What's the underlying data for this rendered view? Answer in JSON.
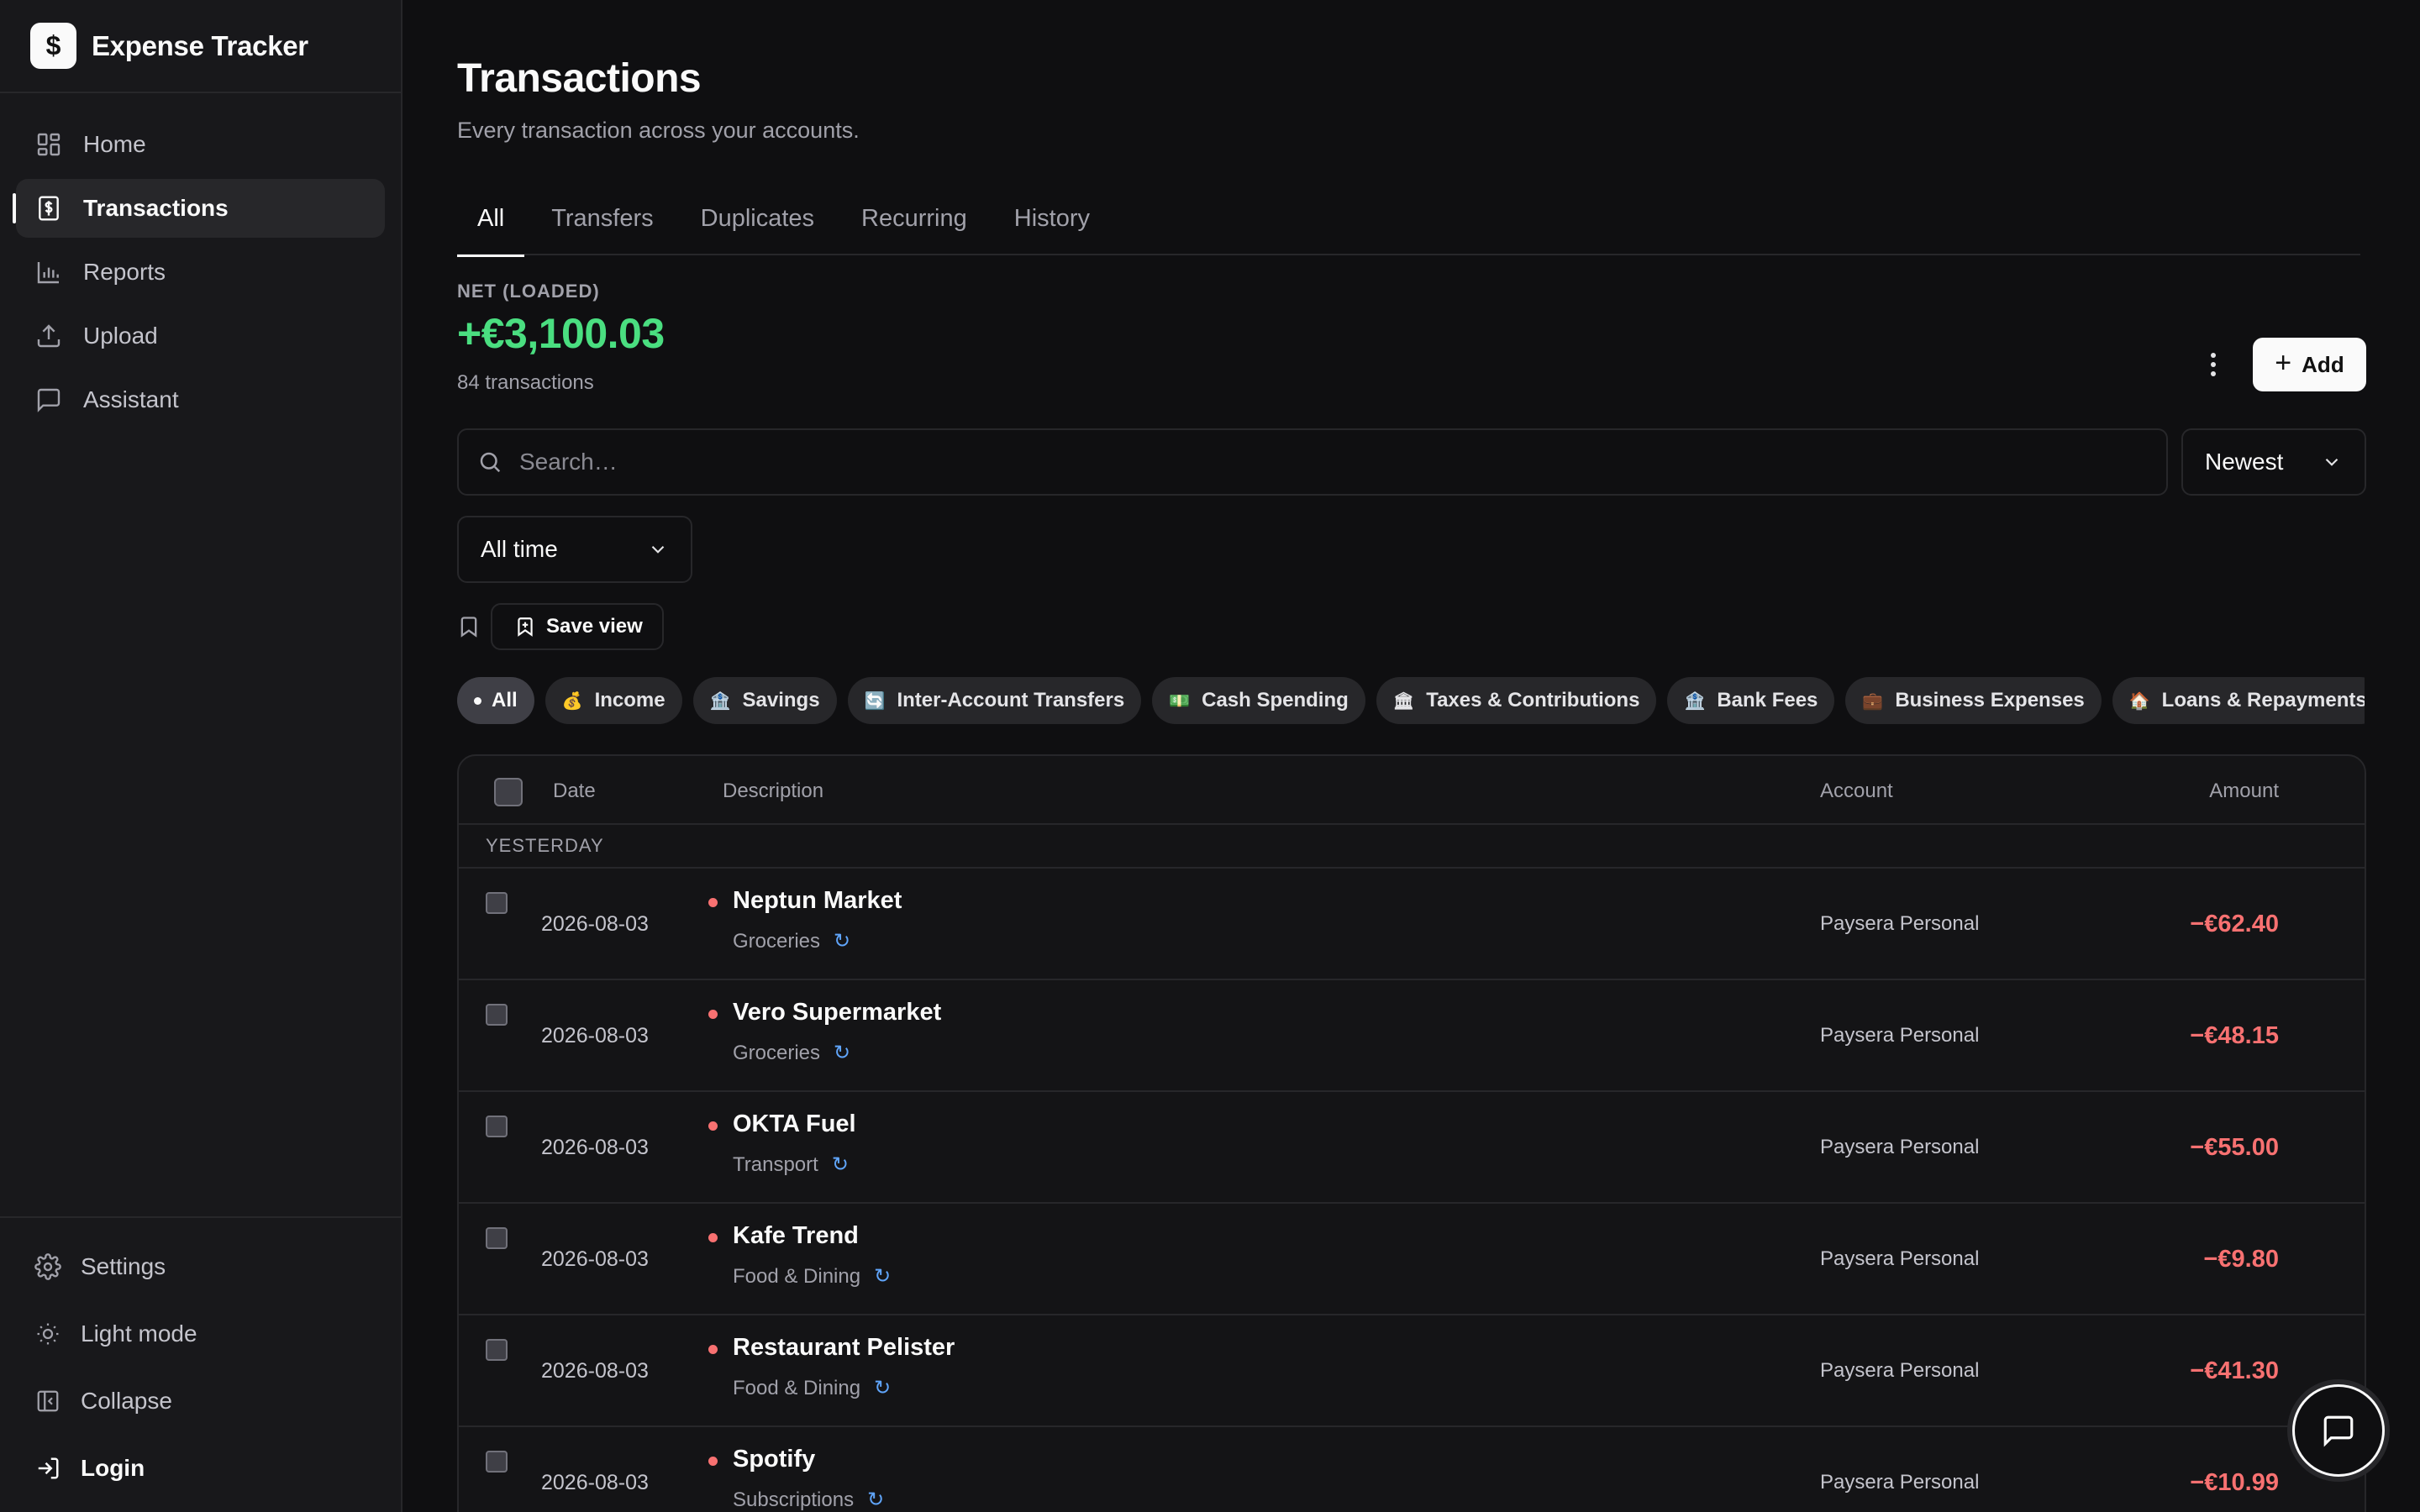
{
  "app": {
    "name": "Expense Tracker",
    "logo_glyph": "$"
  },
  "nav": [
    {
      "label": "Home",
      "icon": "dashboard-icon"
    },
    {
      "label": "Transactions",
      "icon": "receipt-dollar-icon",
      "active": true
    },
    {
      "label": "Reports",
      "icon": "bar-chart-icon"
    },
    {
      "label": "Upload",
      "icon": "upload-icon"
    },
    {
      "label": "Assistant",
      "icon": "chat-icon"
    }
  ],
  "sidebar_bottom": {
    "settings": "Settings",
    "theme": "Light mode",
    "collapse": "Collapse",
    "login": "Login"
  },
  "page": {
    "title": "Transactions",
    "subtitle": "Every transaction across your accounts."
  },
  "tabs": [
    "All",
    "Transfers",
    "Duplicates",
    "Recurring",
    "History"
  ],
  "summary": {
    "label": "NET (LOADED)",
    "value": "+€3,100.03",
    "count": "84 transactions"
  },
  "actions": {
    "add_label": "Add",
    "save_view_label": "Save view"
  },
  "search": {
    "placeholder": "Search…",
    "value": ""
  },
  "sort": {
    "selected": "Newest"
  },
  "time_filter": {
    "selected": "All time"
  },
  "chips": [
    {
      "label": "All",
      "emoji": "",
      "active": true
    },
    {
      "label": "Income",
      "emoji": "💰"
    },
    {
      "label": "Savings",
      "emoji": "🏦"
    },
    {
      "label": "Inter-Account Transfers",
      "emoji": "🔄"
    },
    {
      "label": "Cash Spending",
      "emoji": "💵"
    },
    {
      "label": "Taxes & Contributions",
      "emoji": "🏛"
    },
    {
      "label": "Bank Fees",
      "emoji": "🏦"
    },
    {
      "label": "Business Expenses",
      "emoji": "💼"
    },
    {
      "label": "Loans & Repayments",
      "emoji": "🏠"
    }
  ],
  "table": {
    "headers": {
      "date": "Date",
      "description": "Description",
      "account": "Account",
      "amount": "Amount"
    },
    "group_label": "YESTERDAY",
    "rows": [
      {
        "date": "2026-08-03",
        "name": "Neptun Market",
        "category": "Groceries",
        "account": "Paysera Personal",
        "amount": "−€62.40"
      },
      {
        "date": "2026-08-03",
        "name": "Vero Supermarket",
        "category": "Groceries",
        "account": "Paysera Personal",
        "amount": "−€48.15"
      },
      {
        "date": "2026-08-03",
        "name": "OKTA Fuel",
        "category": "Transport",
        "account": "Paysera Personal",
        "amount": "−€55.00"
      },
      {
        "date": "2026-08-03",
        "name": "Kafe Trend",
        "category": "Food & Dining",
        "account": "Paysera Personal",
        "amount": "−€9.80"
      },
      {
        "date": "2026-08-03",
        "name": "Restaurant Pelister",
        "category": "Food & Dining",
        "account": "Paysera Personal",
        "amount": "−€41.30"
      },
      {
        "date": "2026-08-03",
        "name": "Spotify",
        "category": "Subscriptions",
        "account": "Paysera Personal",
        "amount": "−€10.99"
      }
    ]
  },
  "colors": {
    "positive": "#4ade80",
    "negative": "#f87171",
    "recurring": "#60a5fa"
  }
}
